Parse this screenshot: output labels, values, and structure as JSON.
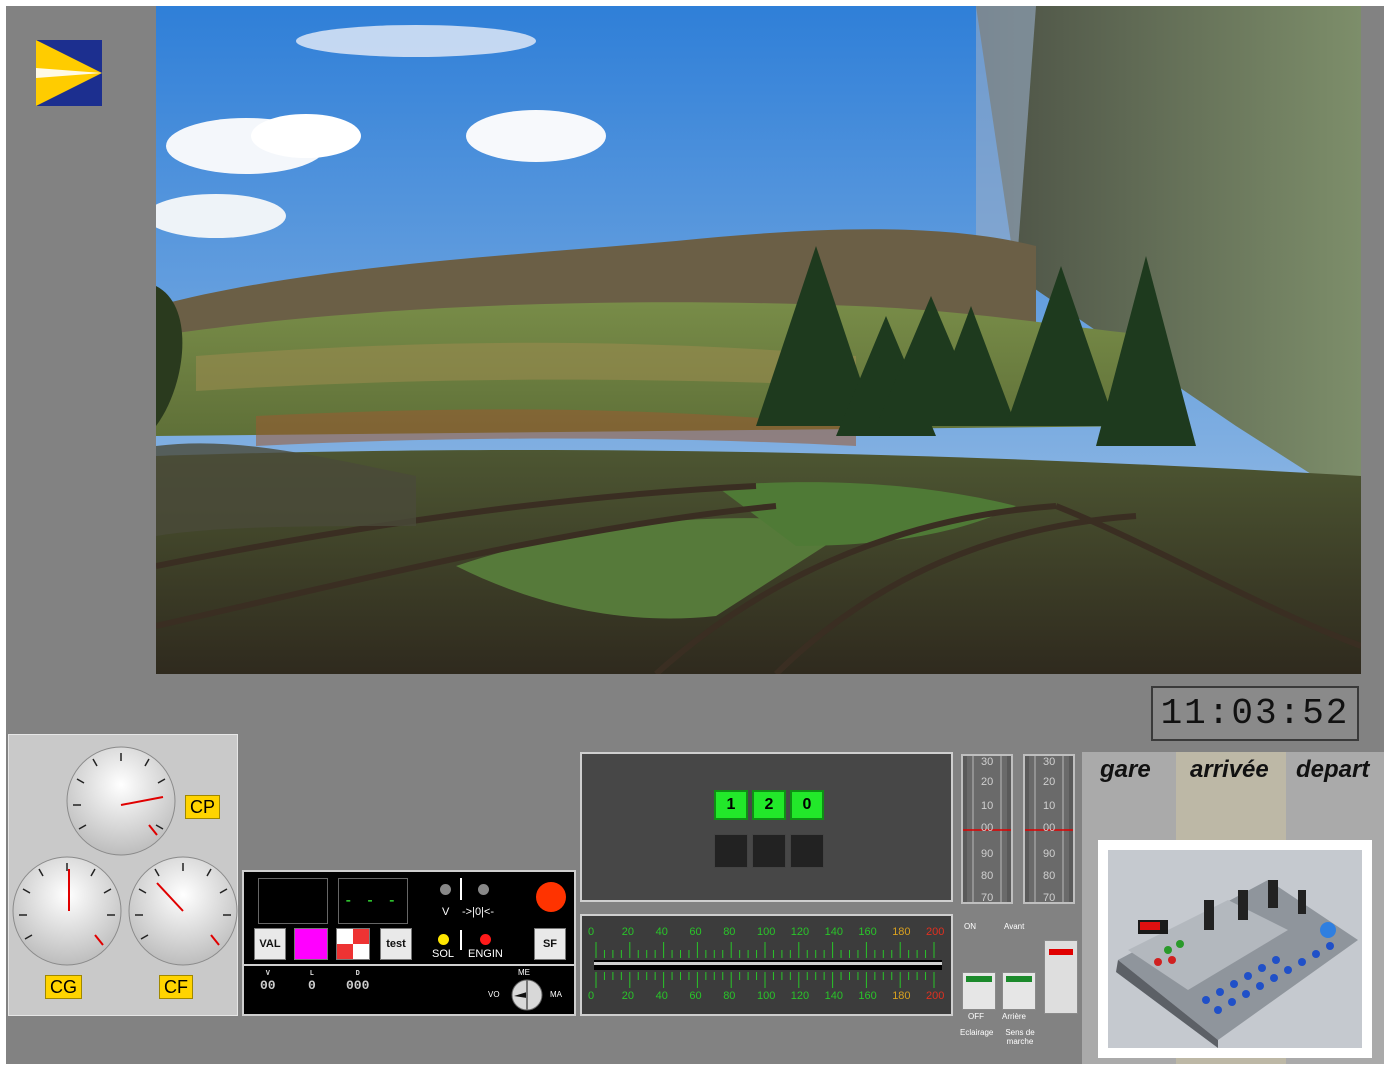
{
  "clock": {
    "time": "11:03:52"
  },
  "gauges": [
    {
      "label": "CP"
    },
    {
      "label": "CG"
    },
    {
      "label": "CF"
    }
  ],
  "kvb": {
    "dashes": "- - -",
    "buttons": {
      "val": "VAL",
      "test": "test",
      "sf": "SF"
    },
    "labels": {
      "v": "V",
      "arrows": "->|0|<-",
      "sol": "SOL",
      "engin": "ENGIN"
    },
    "readouts": [
      {
        "label": "V",
        "value": "00"
      },
      {
        "label": "L",
        "value": "0"
      },
      {
        "label": "D",
        "value": "000"
      }
    ],
    "selector": {
      "top": "ME",
      "left": "VO",
      "right": "MA"
    }
  },
  "speed_setting": {
    "digits": [
      "1",
      "2",
      "0"
    ]
  },
  "speed_scale": {
    "ticks": [
      "0",
      "20",
      "40",
      "60",
      "80",
      "100",
      "120",
      "140",
      "160",
      "180",
      "200"
    ]
  },
  "pressure": {
    "labels": [
      "30",
      "20",
      "10",
      "00",
      "90",
      "80",
      "70"
    ]
  },
  "switches": {
    "on": "ON",
    "avant": "Avant",
    "off": "OFF",
    "arriere": "Arrière",
    "eclairage": "Eclairage",
    "sens": "Sens de marche"
  },
  "station": {
    "gare": "gare",
    "arrivee": "arrivée",
    "depart": "depart"
  },
  "colors": {
    "accent_green": "#22e82a",
    "gauge_label": "#ffd400",
    "alert_red": "#ff3300",
    "magenta": "#ff00ff"
  }
}
